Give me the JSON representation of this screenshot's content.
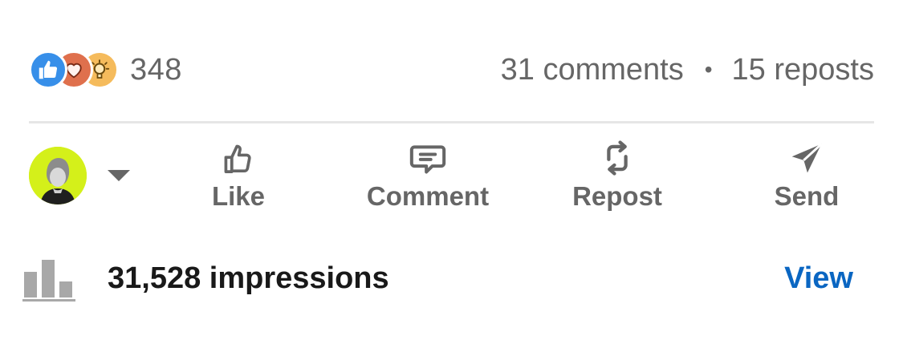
{
  "social_counts": {
    "reactions": [
      {
        "type": "like",
        "icon": "like-reaction-icon",
        "color": "#378fe9"
      },
      {
        "type": "love",
        "icon": "love-reaction-icon",
        "color": "#df704d"
      },
      {
        "type": "insightful",
        "icon": "insightful-reaction-icon",
        "color": "#f5bb5c"
      }
    ],
    "reaction_count": "348",
    "comments": "31 comments",
    "separator": "•",
    "reposts": "15 reposts"
  },
  "actions": {
    "avatar_accent": "#d4f01a",
    "like_label": "Like",
    "comment_label": "Comment",
    "repost_label": "Repost",
    "send_label": "Send"
  },
  "impressions": {
    "text": "31,528 impressions",
    "view_label": "View",
    "link_color": "#0a66c2"
  }
}
